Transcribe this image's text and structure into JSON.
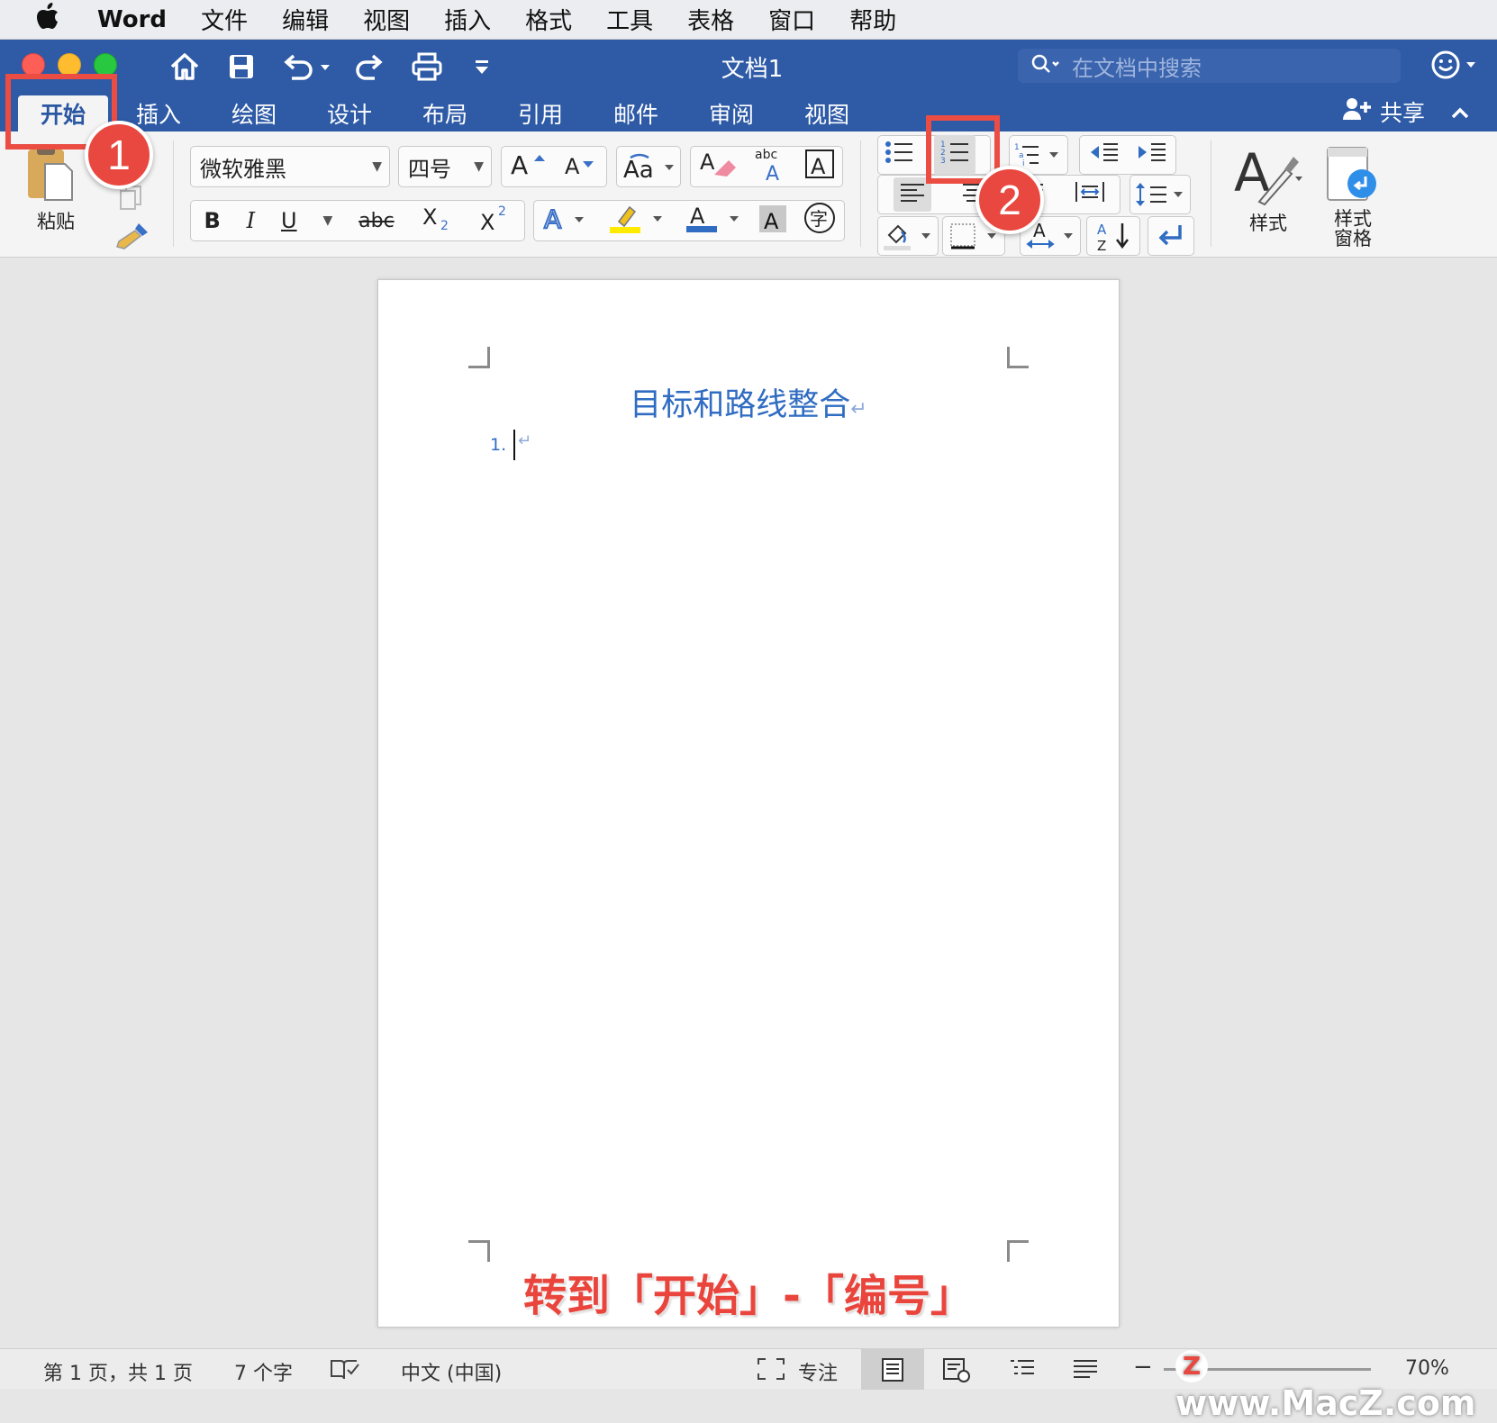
{
  "menubar": {
    "app": "Word",
    "items": [
      "文件",
      "编辑",
      "视图",
      "插入",
      "格式",
      "工具",
      "表格",
      "窗口",
      "帮助"
    ]
  },
  "titlebar": {
    "doc_title": "文档1",
    "search_placeholder": "在文档中搜索"
  },
  "ribbon_tabs": [
    "开始",
    "插入",
    "绘图",
    "设计",
    "布局",
    "引用",
    "邮件",
    "审阅",
    "视图"
  ],
  "share_label": "共享",
  "ribbon": {
    "paste_label": "粘贴",
    "font_name": "微软雅黑",
    "font_size": "四号",
    "bold": "B",
    "italic": "I",
    "underline": "U",
    "strike": "abc",
    "styles_label": "样式",
    "styles_pane_label_1": "样式",
    "styles_pane_label_2": "窗格"
  },
  "annotations": {
    "badge1": "1",
    "badge2": "2",
    "caption": "转到「开始」-「编号」"
  },
  "document": {
    "heading": "目标和路线整合",
    "list_marker": "1."
  },
  "status": {
    "page": "第 1 页，共 1 页",
    "words": "7 个字",
    "language": "中文 (中国)",
    "focus": "专注",
    "zoom": "70%"
  },
  "watermark": "www.MacZ.com",
  "colors": {
    "ribbon_blue": "#2e5aa6",
    "annotation_red": "#e8483f",
    "heading_blue": "#2f6cc2"
  }
}
